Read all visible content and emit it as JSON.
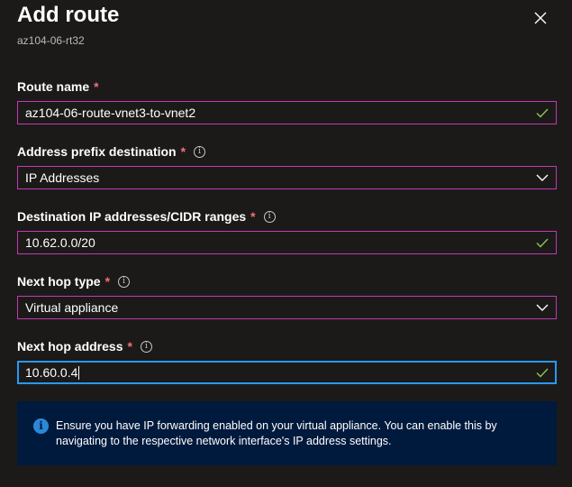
{
  "header": {
    "title": "Add route",
    "subtitle": "az104-06-rt32",
    "close_icon": "close-icon"
  },
  "fields": {
    "route_name": {
      "label": "Route name",
      "required": "*",
      "value": "az104-06-route-vnet3-to-vnet2"
    },
    "address_prefix_destination": {
      "label": "Address prefix destination",
      "required": "*",
      "value": "IP Addresses"
    },
    "destination_ranges": {
      "label": "Destination IP addresses/CIDR ranges",
      "required": "*",
      "value": "10.62.0.0/20"
    },
    "next_hop_type": {
      "label": "Next hop type",
      "required": "*",
      "value": "Virtual appliance"
    },
    "next_hop_address": {
      "label": "Next hop address",
      "required": "*",
      "value": "10.60.0.4"
    }
  },
  "notice": {
    "icon": "info-icon",
    "text": "Ensure you have IP forwarding enabled on your virtual appliance. You can enable this by navigating to the respective network interface's IP address settings."
  },
  "colors": {
    "background": "#1b1a19",
    "input_border": "#c239b3",
    "focus_border": "#2899f5",
    "required": "#f1707b",
    "valid_check": "#92c353",
    "notice_bg": "#001a3d",
    "notice_icon": "#2b88d8"
  }
}
